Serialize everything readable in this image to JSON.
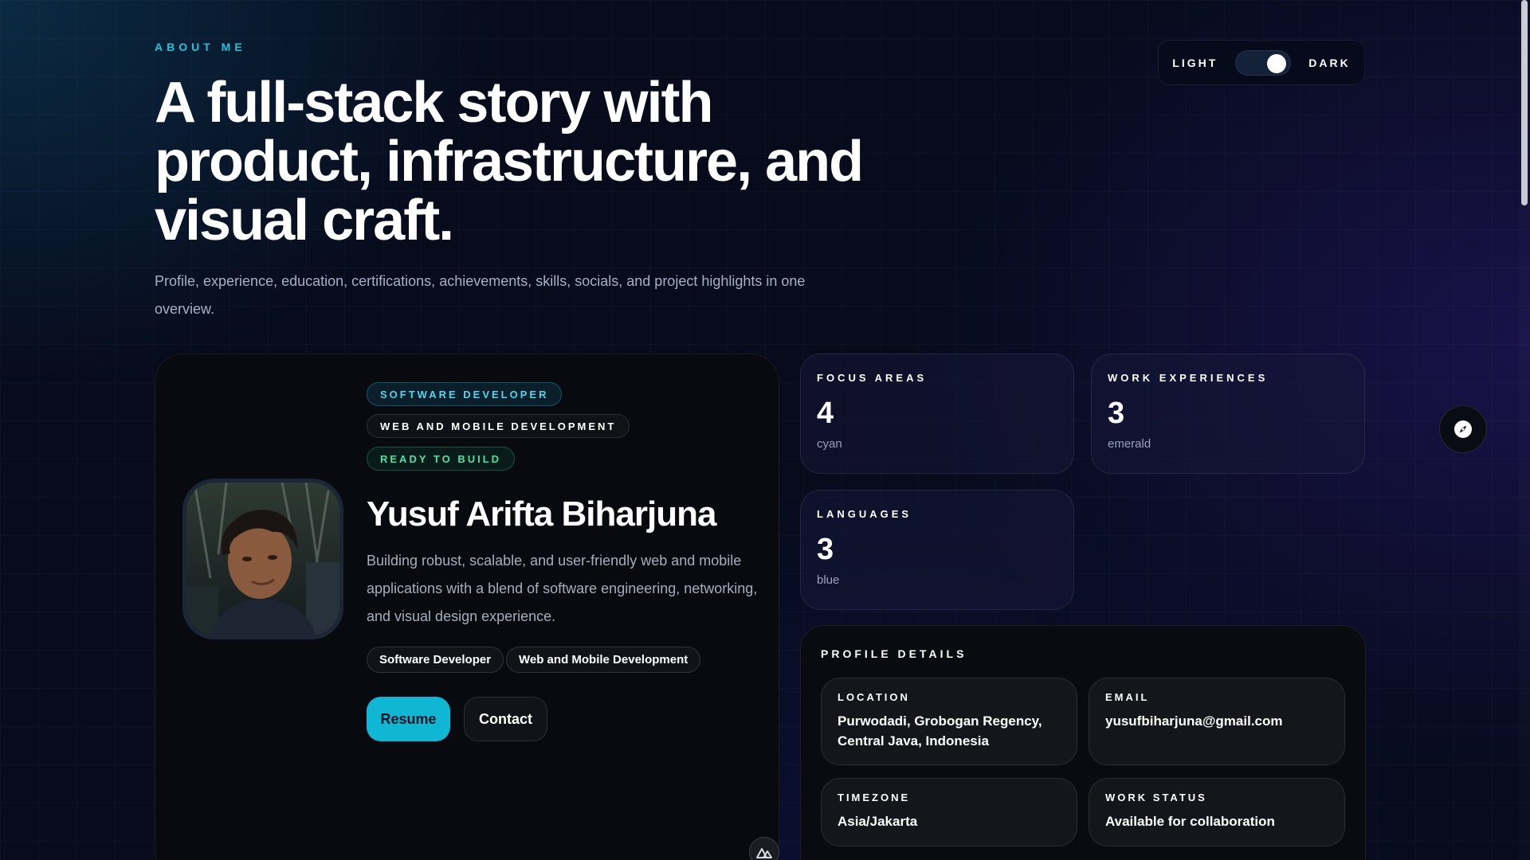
{
  "hero": {
    "eyebrow": "ABOUT ME",
    "title": "A full-stack story with product, infrastructure, and visual craft.",
    "subtitle": "Profile, experience, education, certifications, achievements, skills, socials, and project highlights in one overview."
  },
  "theme_toggle": {
    "light_label": "LIGHT",
    "dark_label": "DARK",
    "state": "dark"
  },
  "profile": {
    "chips": [
      "SOFTWARE DEVELOPER",
      "WEB AND MOBILE DEVELOPMENT",
      "READY TO BUILD"
    ],
    "name": "Yusuf Arifta Biharjuna",
    "bio": "Building robust, scalable, and user-friendly web and mobile applications with a blend of software engineering, networking, and visual design experience.",
    "tags": [
      "Software Developer",
      "Web and Mobile Development"
    ],
    "resume_label": "Resume",
    "contact_label": "Contact",
    "avatar_icon": "profile-photo",
    "corner_icon": "nuxt-logo-icon"
  },
  "stats": [
    {
      "label": "FOCUS AREAS",
      "value": "4",
      "sub": "cyan"
    },
    {
      "label": "WORK EXPERIENCES",
      "value": "3",
      "sub": "emerald"
    },
    {
      "label": "LANGUAGES",
      "value": "3",
      "sub": "blue"
    }
  ],
  "details": {
    "title": "PROFILE DETAILS",
    "fields": [
      {
        "label": "LOCATION",
        "value": "Purwodadi, Grobogan Regency, Central Java, Indonesia"
      },
      {
        "label": "EMAIL",
        "value": "yusufbiharjuna@gmail.com"
      },
      {
        "label": "TIMEZONE",
        "value": "Asia/Jakarta"
      },
      {
        "label": "WORK STATUS",
        "value": "Available for collaboration"
      }
    ]
  },
  "compass_icon": "compass-icon",
  "colors": {
    "accent": "#0fb7d4",
    "eyebrow": "#22c3dd",
    "ready": "#4ee0a8",
    "background": "#070b1c"
  }
}
